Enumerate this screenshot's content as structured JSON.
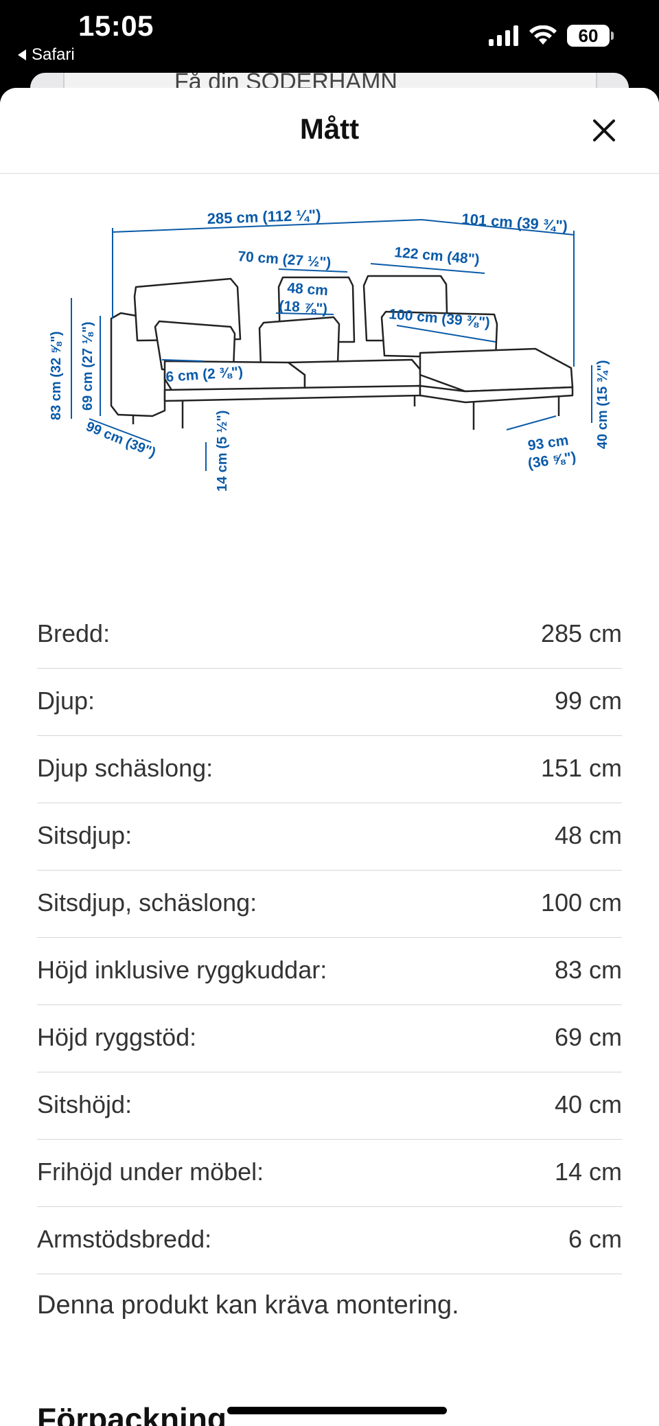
{
  "status_bar": {
    "time": "15:05",
    "back_app": "Safari",
    "battery": "60"
  },
  "background_page": {
    "text": "Få din SÖDERHAMN"
  },
  "sheet": {
    "title": "Mått",
    "close_icon": "close-icon"
  },
  "diagram": {
    "labels": {
      "width_total": "285 cm (112 ¼\")",
      "width_chaise": "101 cm (39 ¾\")",
      "seat_width_70": "70 cm (27 ½\")",
      "chaise_122": "122 cm (48\")",
      "seat_depth_48": "48 cm",
      "seat_depth_48_in": "(18 ⅞\")",
      "chaise_depth_100": "100 cm (39 ⅜\")",
      "armrest_6": "6 cm (2 ⅜\")",
      "height_83": "83 cm (32 ⅝\")",
      "height_69": "69 cm (27 ⅛\")",
      "depth_99": "99 cm (39\")",
      "clearance_14": "14 cm (5 ½\")",
      "chaise_93": "93 cm",
      "chaise_93_in": "(36 ⅝\")",
      "seat_height_40": "40 cm (15 ¾\")"
    }
  },
  "specs": [
    {
      "label": "Bredd:",
      "value": "285 cm"
    },
    {
      "label": "Djup:",
      "value": "99 cm"
    },
    {
      "label": "Djup schäslong:",
      "value": "151 cm"
    },
    {
      "label": "Sitsdjup:",
      "value": "48 cm"
    },
    {
      "label": "Sitsdjup, schäslong:",
      "value": "100 cm"
    },
    {
      "label": "Höjd inklusive ryggkuddar:",
      "value": "83 cm"
    },
    {
      "label": "Höjd ryggstöd:",
      "value": "69 cm"
    },
    {
      "label": "Sitshöjd:",
      "value": "40 cm"
    },
    {
      "label": "Frihöjd under möbel:",
      "value": "14 cm"
    },
    {
      "label": "Armstödsbredd:",
      "value": "6 cm"
    }
  ],
  "note": "Denna produkt kan kräva montering.",
  "next_section_title": "Förpackning"
}
